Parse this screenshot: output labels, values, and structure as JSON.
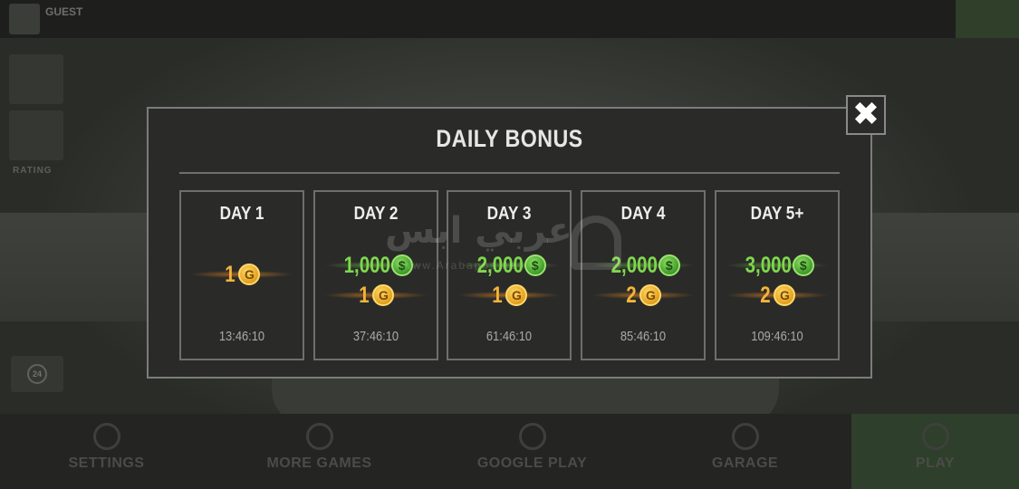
{
  "topbar": {
    "user_name": "GUEST"
  },
  "side": {
    "label": "RATING"
  },
  "bottom_nav": {
    "items": [
      {
        "label": "SETTINGS"
      },
      {
        "label": "MORE GAMES"
      },
      {
        "label": "GOOGLE PLAY"
      },
      {
        "label": "GARAGE"
      },
      {
        "label": "PLAY"
      }
    ]
  },
  "modal": {
    "title": "DAILY BONUS",
    "close_symbol": "✖",
    "days": [
      {
        "label": "DAY 1",
        "cash": null,
        "gold": "1",
        "timer": "13:46:10"
      },
      {
        "label": "DAY 2",
        "cash": "1,000",
        "gold": "1",
        "timer": "37:46:10"
      },
      {
        "label": "DAY 3",
        "cash": "2,000",
        "gold": "1",
        "timer": "61:46:10"
      },
      {
        "label": "DAY 4",
        "cash": "2,000",
        "gold": "2",
        "timer": "85:46:10"
      },
      {
        "label": "DAY 5+",
        "cash": "3,000",
        "gold": "2",
        "timer": "109:46:10"
      }
    ],
    "cash_coin_symbol": "$",
    "gold_coin_symbol": "G"
  },
  "watermark": {
    "text": "عربي ابس",
    "sub": "www.Arabapps.net"
  },
  "colors": {
    "cash_green": "#7fd84c",
    "gold_orange": "#f4b43a",
    "panel_bg": "#2a2b29",
    "border": "#6e6f6c"
  },
  "icons": {
    "close": "close-icon",
    "cash_coin": "cash-coin-icon",
    "gold_coin": "gold-coin-icon",
    "settings": "gear-icon",
    "more_games": "controller-icon",
    "google_play": "gamepad-icon",
    "garage": "motorcycle-icon"
  }
}
